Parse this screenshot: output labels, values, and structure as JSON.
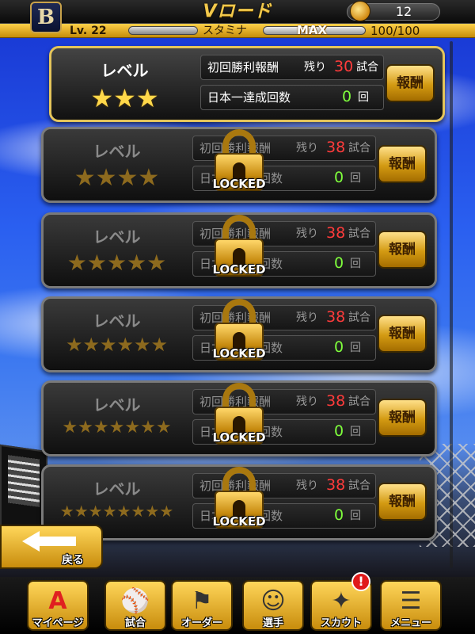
{
  "header": {
    "logo_letter": "B",
    "title": "Vロード",
    "coins": "12",
    "level": "Lv. 22",
    "stamina_label": "スタミナ",
    "stamina_max": "MAX",
    "stamina_value": "100/100"
  },
  "labels": {
    "level": "レベル",
    "first_win_reward": "初回勝利報酬",
    "remaining": "残り",
    "games_unit": "試合",
    "japan_champ": "日本一達成回数",
    "count_unit": "回",
    "reward_button": "報酬",
    "locked": "LOCKED"
  },
  "cards": [
    {
      "stars": 3,
      "remaining_games": "30",
      "champ_count": "0",
      "locked": false
    },
    {
      "stars": 4,
      "remaining_games": "38",
      "champ_count": "0",
      "locked": true
    },
    {
      "stars": 5,
      "remaining_games": "38",
      "champ_count": "0",
      "locked": true
    },
    {
      "stars": 6,
      "remaining_games": "38",
      "champ_count": "0",
      "locked": true
    },
    {
      "stars": 7,
      "remaining_games": "38",
      "champ_count": "0",
      "locked": true
    },
    {
      "stars": 8,
      "remaining_games": "38",
      "champ_count": "0",
      "locked": true
    }
  ],
  "back_button": {
    "label": "戻る"
  },
  "nav": [
    {
      "label": "マイページ",
      "icon": "letter-a-icon",
      "glyph": "A"
    },
    {
      "label": "試合",
      "icon": "stadium-icon",
      "glyph": "⚾"
    },
    {
      "label": "オーダー",
      "icon": "lineup-icon",
      "glyph": "⚑"
    },
    {
      "label": "選手",
      "icon": "player-icon",
      "glyph": "☺"
    },
    {
      "label": "スカウト",
      "icon": "scout-icon",
      "glyph": "✦"
    },
    {
      "label": "メニュー",
      "icon": "menu-character-icon",
      "glyph": "☰"
    }
  ],
  "scout_badge": "!"
}
